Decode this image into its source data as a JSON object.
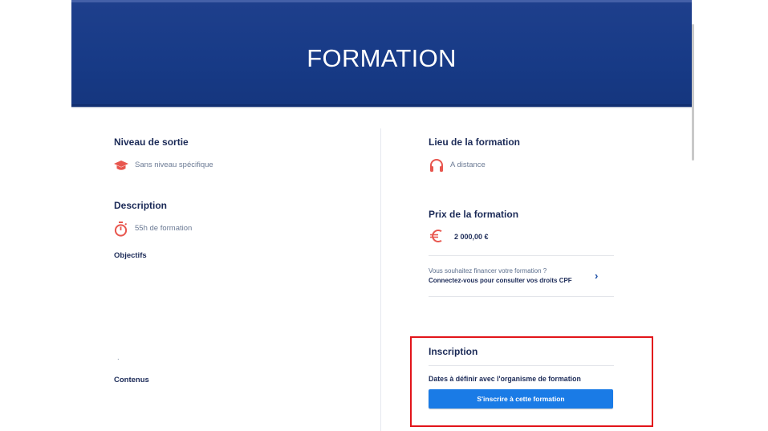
{
  "banner": {
    "title": "FORMATION"
  },
  "left": {
    "niveau": {
      "heading": "Niveau de sortie",
      "value": "Sans niveau spécifique"
    },
    "description": {
      "heading": "Description",
      "value": "55h de formation"
    },
    "objectifs_label": "Objectifs",
    "dot": ".",
    "contenus_label": "Contenus"
  },
  "right": {
    "lieu": {
      "heading": "Lieu de la formation",
      "value": "A distance"
    },
    "prix": {
      "heading": "Prix de la formation",
      "value": "2 000,00 €"
    },
    "cpf": {
      "question": "Vous souhaitez financer votre formation ?",
      "link": "Connectez-vous pour consulter vos droits CPF"
    },
    "inscription": {
      "heading": "Inscription",
      "dates": "Dates à définir avec l'organisme de formation",
      "cta": "S'inscrire à cette formation"
    }
  },
  "icons": {
    "graduation": "graduation-cap-icon",
    "timer": "stopwatch-icon",
    "headphones": "headphones-icon",
    "euro": "euro-icon",
    "chevron": "chevron-right-icon"
  },
  "colors": {
    "banner": "#173a86",
    "accent_icon": "#e8564e",
    "cta": "#1a7be6",
    "highlight": "#e2141a"
  }
}
